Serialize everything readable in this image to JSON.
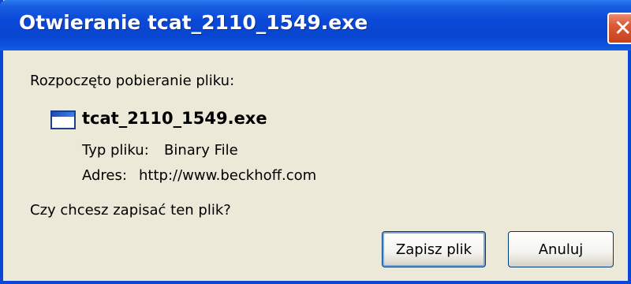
{
  "dialog": {
    "title": "Otwieranie tcat_2110_1549.exe",
    "close_glyph": "✕",
    "intro": "Rozpoczęto pobieranie pliku:",
    "file": {
      "icon": "application-window-icon",
      "name": "tcat_2110_1549.exe",
      "type_label": "Typ pliku:",
      "type_value": "Binary File",
      "address_label": "Adres:",
      "address_value": "http://www.beckhoff.com"
    },
    "question": "Czy chcesz zapisać ten plik?",
    "buttons": {
      "save": "Zapisz plik",
      "cancel": "Anuluj"
    }
  },
  "colors": {
    "titlebar": "#0a49d8",
    "window_bg": "#ece9d8",
    "close_button": "#d85a36"
  }
}
